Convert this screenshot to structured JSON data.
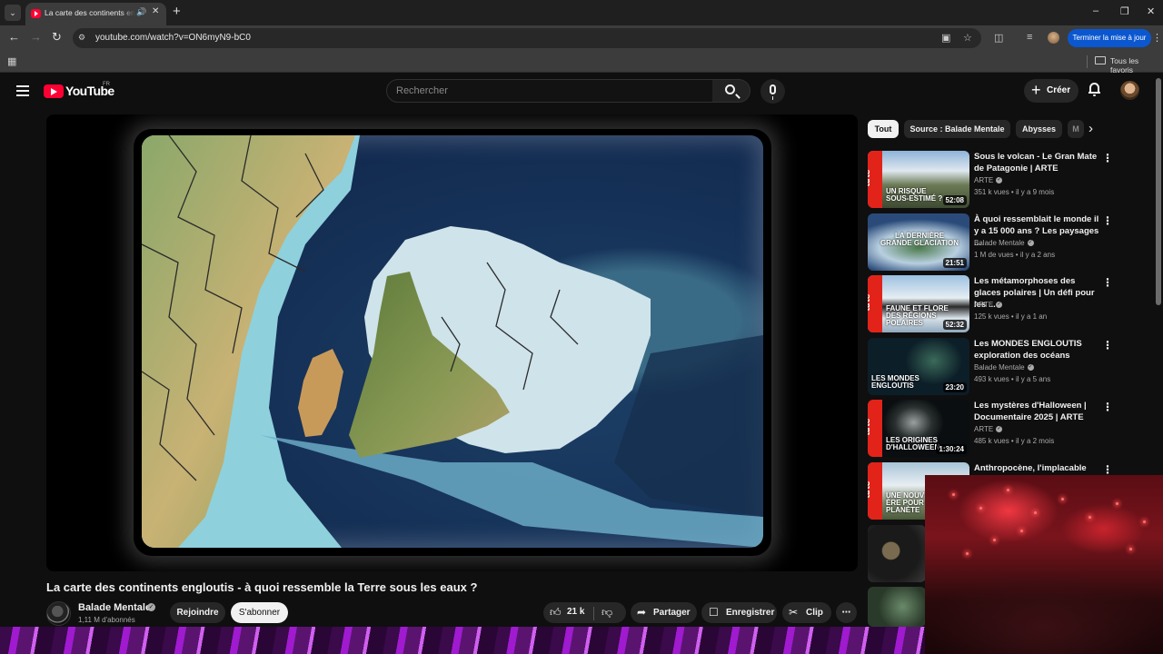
{
  "browser": {
    "tab_title": "La carte des continents englouti",
    "url": "youtube.com/watch?v=ON6myN9-bC0",
    "update_label": "Terminer la mise à jour",
    "bookmarks_label": "Tous les favoris"
  },
  "header": {
    "logo_text": "YouTube",
    "country_code": "FR",
    "search_placeholder": "Rechercher",
    "create_label": "Créer"
  },
  "video": {
    "title": "La carte des continents engloutis - à quoi ressemble la Terre sous les eaux ?",
    "channel": "Balade Mentale",
    "subscribers": "1,11 M d'abonnés",
    "join_label": "Rejoindre",
    "subscribe_label": "S'abonner",
    "likes": "21 k",
    "share_label": "Partager",
    "save_label": "Enregistrer",
    "clip_label": "Clip"
  },
  "chips": [
    "Tout",
    "Source : Balade Mentale",
    "Abysses",
    "M"
  ],
  "recommendations": [
    {
      "title": "Sous le volcan - Le Gran Mate de Patagonie | ARTE",
      "channel": "ARTE",
      "views": "351 k vues",
      "age": "il y a 9 mois",
      "duration": "52:08",
      "overlay": "UN RISQUE SOUS-ESTIMÉ ?",
      "arte": true
    },
    {
      "title": "À quoi ressemblait le monde il y a 15 000 ans ? Les paysages ...",
      "channel": "Balade Mentale",
      "views": "1 M de vues",
      "age": "il y a 2 ans",
      "duration": "21:51",
      "overlay": "LA DERNIÈRE GRANDE GLACIATION",
      "arte": false
    },
    {
      "title": "Les métamorphoses des glaces polaires | Un défi pour les ...",
      "channel": "ARTE",
      "views": "125 k vues",
      "age": "il y a 1 an",
      "duration": "52:32",
      "overlay": "FAUNE ET FLORE DES RÉGIONS POLAIRES",
      "arte": true
    },
    {
      "title": "Les MONDES ENGLOUTIS exploration des océans",
      "channel": "Balade Mentale",
      "views": "493 k vues",
      "age": "il y a 5 ans",
      "duration": "23:20",
      "overlay": "LES MONDES ENGLOUTIS",
      "arte": false
    },
    {
      "title": "Les mystères d'Halloween | Documentaire 2025 | ARTE",
      "channel": "ARTE",
      "views": "485 k vues",
      "age": "il y a 2 mois",
      "duration": "1:30:24",
      "overlay": "LES ORIGINES D'HALLOWEEN",
      "arte": true
    },
    {
      "title": "Anthropocène, l'implacable",
      "channel": "",
      "views": "",
      "age": "",
      "duration": "",
      "overlay": "UNE NOUVELLE ÈRE POUR LA PLANÈTE",
      "arte": true
    }
  ]
}
